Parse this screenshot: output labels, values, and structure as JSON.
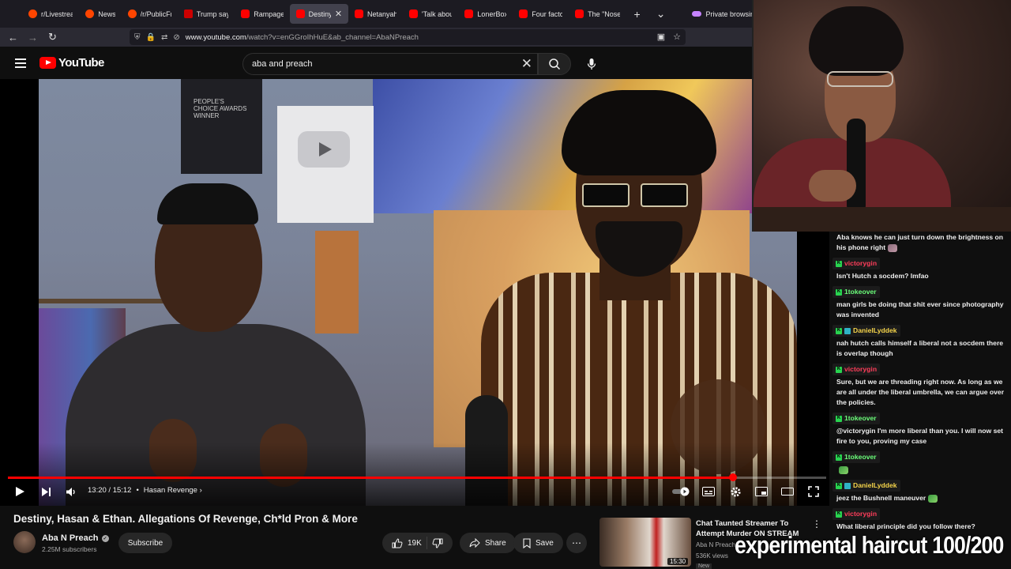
{
  "browser": {
    "tabs": [
      {
        "label": "r/Livestrea",
        "icon": "reddit-icon",
        "active": false
      },
      {
        "label": "News",
        "icon": "reddit-icon",
        "active": false
      },
      {
        "label": "/r/PublicFr",
        "icon": "reddit-icon",
        "active": false
      },
      {
        "label": "Trump say",
        "icon": "cnn-icon",
        "active": false
      },
      {
        "label": "Rampage",
        "icon": "youtube-icon",
        "active": false
      },
      {
        "label": "Destiny",
        "icon": "youtube-icon",
        "active": true
      },
      {
        "label": "Netanyah",
        "icon": "youtube-icon",
        "active": false
      },
      {
        "label": "'Talk abou",
        "icon": "youtube-icon",
        "active": false
      },
      {
        "label": "LonerBox",
        "icon": "youtube-icon",
        "active": false
      },
      {
        "label": "Four facto",
        "icon": "youtube-icon",
        "active": false
      },
      {
        "label": "The \"Nose",
        "icon": "youtube-icon",
        "active": false
      }
    ],
    "private_label": "Private browsing",
    "url_host": "www.youtube.com",
    "url_rest": "/watch?v=enGGroIhHuE&ab_channel=AbaNPreach"
  },
  "youtube": {
    "logo_text": "YouTube",
    "search_value": "aba and preach"
  },
  "player": {
    "time": "13:20 / 15:12",
    "chapter": "Hasan Revenge",
    "progress": 0.886,
    "award_text": "PEOPLE'S CHOICE AWARDS WINNER"
  },
  "video": {
    "title": "Destiny, Hasan & Ethan. Allegations Of Revenge, Ch*ld Pron & More",
    "channel": "Aba N Preach",
    "subscribers": "2.25M subscribers",
    "subscribe_label": "Subscribe",
    "likes": "19K",
    "share_label": "Share",
    "save_label": "Save"
  },
  "recommended": {
    "title": "Chat Taunted Streamer To Attempt Murder ON STREAM",
    "channel": "Aba N Preach",
    "meta": "536K views",
    "duration": "15:30",
    "badge": "New"
  },
  "chat": {
    "messages": [
      {
        "user": "",
        "text": "Aba knows he can just turn down the brightness on his phone right",
        "emote": "cat"
      },
      {
        "user": "victorygin",
        "color": "red",
        "badges": [
          "k"
        ],
        "text": "Isn't Hutch a socdem? lmfao"
      },
      {
        "user": "1tokeover",
        "color": "green",
        "badges": [
          "k"
        ],
        "text": "man girls be doing that shit ever since photography was invented"
      },
      {
        "user": "DanielLyddek",
        "color": "yellow",
        "badges": [
          "k",
          "gift"
        ],
        "text": "nah hutch calls himself a liberal not a socdem there is overlap though"
      },
      {
        "user": "victorygin",
        "color": "red",
        "badges": [
          "k"
        ],
        "text": "Sure, but we are threading right now. As long as we are all under the liberal umbrella, we can argue over the policies."
      },
      {
        "user": "1tokeover",
        "color": "green",
        "badges": [
          "k"
        ],
        "text": "@victorygin I'm more liberal than you. I will now set fire to you, proving my case"
      },
      {
        "user": "1tokeover",
        "color": "green",
        "badges": [
          "k"
        ],
        "text": "",
        "emote": "plant"
      },
      {
        "user": "DanielLyddek",
        "color": "yellow",
        "badges": [
          "k",
          "gift"
        ],
        "text": "jeez the Bushnell maneuver",
        "emote": "plant"
      },
      {
        "user": "victorygin",
        "color": "red",
        "badges": [
          "k"
        ],
        "text": "What liberal principle did you follow there?"
      }
    ]
  },
  "overlay": {
    "text": "experimental haircut 100/200"
  }
}
